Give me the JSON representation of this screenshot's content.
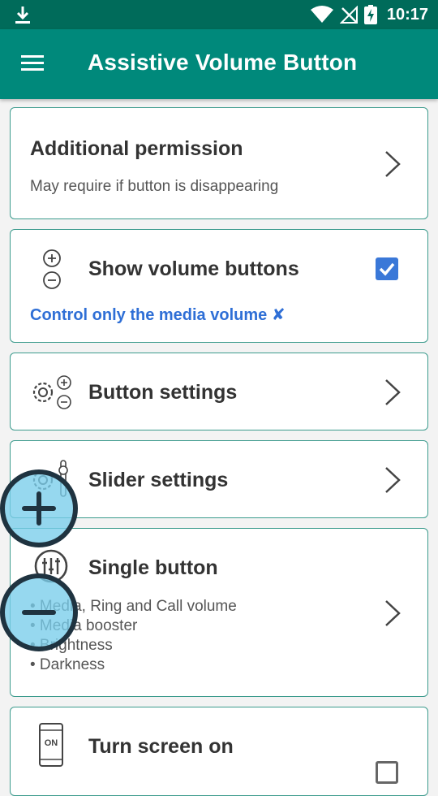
{
  "status_bar": {
    "time": "10:17"
  },
  "app_bar": {
    "title": "Assistive Volume Button"
  },
  "cards": {
    "permission": {
      "title": "Additional permission",
      "subtitle": "May require if button is disappearing"
    },
    "show_volume": {
      "title": "Show volume buttons",
      "checked": true,
      "link": "Control only the media volume ✘"
    },
    "button_settings": {
      "title": "Button settings"
    },
    "slider_settings": {
      "title": "Slider settings"
    },
    "single_button": {
      "title": "Single button",
      "bullets": [
        "• Media, Ring and Call volume",
        "• Media booster",
        "• Brightness",
        "• Darkness"
      ]
    },
    "turn_screen_on": {
      "title": "Turn screen on",
      "icon_text": "ON",
      "checked": false
    }
  },
  "colors": {
    "status_bar": "#006b5a",
    "app_bar": "#00897b",
    "accent_link": "#2f6fd6",
    "checkbox": "#3a78d8"
  }
}
